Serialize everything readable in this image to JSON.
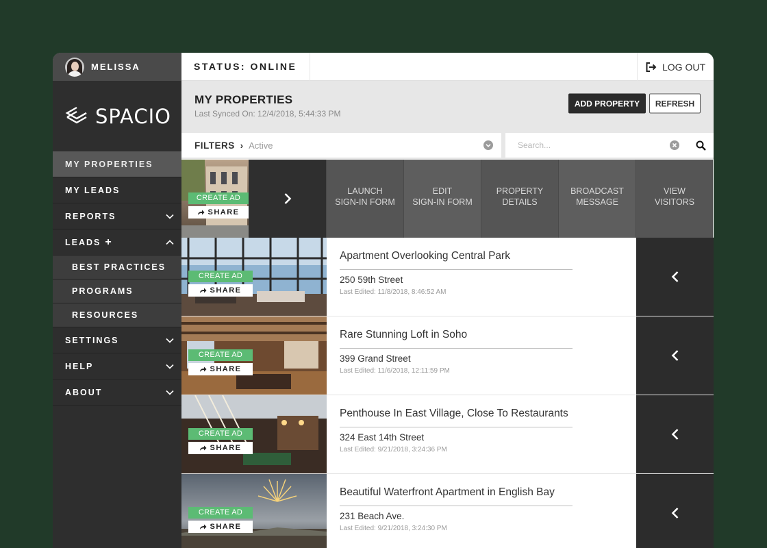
{
  "user": {
    "name": "MELISSA"
  },
  "brand": {
    "name": "SPACIO"
  },
  "sidebar": {
    "items": [
      {
        "label": "MY PROPERTIES",
        "active": true
      },
      {
        "label": "MY LEADS"
      },
      {
        "label": "REPORTS",
        "icon": "chevron-down-icon"
      },
      {
        "label": "LEADS",
        "icon": "chevron-up-icon"
      },
      {
        "label": "BEST PRACTICES"
      },
      {
        "label": "PROGRAMS"
      },
      {
        "label": "RESOURCES"
      },
      {
        "label": "SETTINGS",
        "icon": "chevron-down-icon"
      },
      {
        "label": "HELP",
        "icon": "chevron-down-icon"
      },
      {
        "label": "ABOUT",
        "icon": "chevron-down-icon"
      }
    ]
  },
  "topbar": {
    "status": "STATUS: ONLINE",
    "logout": "LOG OUT"
  },
  "header": {
    "title": "MY PROPERTIES",
    "synced": "Last Synced On: 12/4/2018, 5:44:33 PM",
    "add_label": "ADD PROPERTY",
    "refresh_label": "REFRESH"
  },
  "filters": {
    "label": "FILTERS",
    "value": "Active"
  },
  "search": {
    "placeholder": "Search..."
  },
  "row_buttons": {
    "create_ad": "CREATE AD",
    "share": "SHARE"
  },
  "actions": [
    {
      "label": "LAUNCH\nSIGN-IN FORM"
    },
    {
      "label": "EDIT\nSIGN-IN FORM"
    },
    {
      "label": "PROPERTY\nDETAILS"
    },
    {
      "label": "BROADCAST\nMESSAGE"
    },
    {
      "label": "VIEW\nVISITORS"
    }
  ],
  "properties": [
    {
      "title": "Apartment Overlooking Central Park",
      "address": "250 59th Street",
      "edited": "Last Edited: 11/8/2018, 8:46:52 AM"
    },
    {
      "title": "Rare Stunning Loft in Soho",
      "address": "399 Grand Street",
      "edited": "Last Edited: 11/6/2018, 12:11:59 PM"
    },
    {
      "title": "Penthouse In East Village, Close To Restaurants",
      "address": "324 East 14th Street",
      "edited": "Last Edited: 9/21/2018, 3:24:36 PM"
    },
    {
      "title": "Beautiful Waterfront Apartment in English Bay",
      "address": "231 Beach Ave.",
      "edited": "Last Edited: 9/21/2018, 3:24:30 PM"
    }
  ],
  "colors": {
    "background": "#213a29",
    "sidebar": "#2e2e2e",
    "accent": "#5cbb74",
    "dark": "#2c2c2c"
  }
}
